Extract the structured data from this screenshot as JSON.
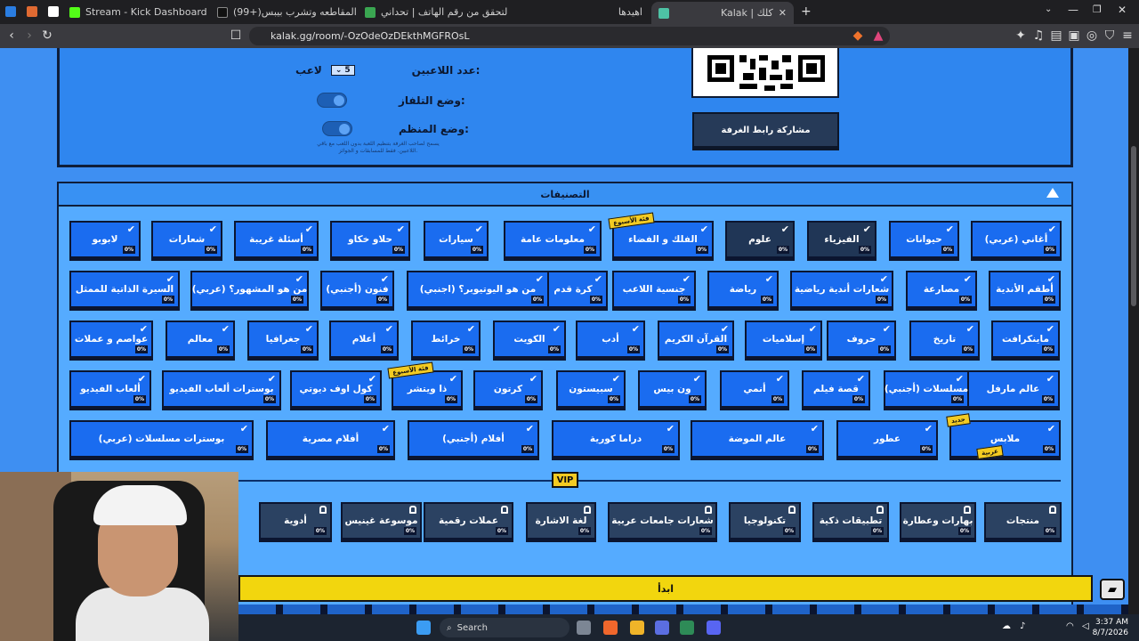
{
  "browser": {
    "tabs": [
      {
        "label": "Stream - Kick Dashboard"
      },
      {
        "label": "(99+)متنساش المقاطعه وتشرب بيبس"
      },
      {
        "label": "التحقق من رقم الهاتف | تحداني"
      },
      {
        "label": "اهيدها"
      },
      {
        "label": "Kalak | كلك"
      }
    ],
    "url": "kalak.gg/room/-OzOdeOzDEkthMGFROsL"
  },
  "settings": {
    "players_label": "عدد اللاعبين:",
    "players_value": "5",
    "players_unit": "لاعب",
    "tv_mode_label": "وضع التلفاز:",
    "organizer_mode_label": "وضع المنظم:",
    "organizer_note": "يسمح لصاحب الغرفة بتنظيم اللعبة بدون اللعب مع باقي اللاعبين. فقط للمسابقات و الجوائز."
  },
  "share_button": "مشاركة رابط الغرفة",
  "categories_title": "التصنيفات",
  "vip_label": "VIP",
  "start_button": "ابدأ",
  "rows": [
    [
      {
        "label": "أغاني (عربي)",
        "pct": "0%"
      },
      {
        "label": "حيوانات",
        "pct": "0%"
      },
      {
        "label": "الفيزياء",
        "pct": "0%"
      },
      {
        "label": "علوم",
        "pct": "0%"
      },
      {
        "label": "الفلك و الفضاء",
        "pct": "0%"
      },
      {
        "label": "معلومات عامة",
        "pct": "0%"
      },
      {
        "label": "سيارات",
        "pct": "0%"
      },
      {
        "label": "حلاو خكاو",
        "pct": "0%"
      },
      {
        "label": "أسئلة غريبة",
        "pct": "0%"
      },
      {
        "label": "شعارات",
        "pct": "0%"
      },
      {
        "label": "لابوبو",
        "pct": "0%"
      }
    ],
    [
      {
        "label": "أطقم الأندية",
        "pct": "0%"
      },
      {
        "label": "مصارعة",
        "pct": "0%"
      },
      {
        "label": "شعارات أندية رياضية",
        "pct": "0%"
      },
      {
        "label": "رياضة",
        "pct": "0%"
      },
      {
        "label": "جنسية اللاعب",
        "pct": "0%"
      },
      {
        "label": "كرة قدم",
        "pct": "0%"
      },
      {
        "label": "من هو اليوتيوبر؟ (اجنبي)",
        "pct": "0%"
      },
      {
        "label": "فنون (أجنبي)",
        "pct": "0%"
      },
      {
        "label": "من هو المشهور؟ (عربي)",
        "pct": "0%"
      },
      {
        "label": "السيرة الذاتية للممثل",
        "pct": "0%"
      }
    ],
    [
      {
        "label": "ماينكرافت",
        "pct": "0%"
      },
      {
        "label": "تاريخ",
        "pct": "0%"
      },
      {
        "label": "حروف",
        "pct": "0%"
      },
      {
        "label": "إسلاميات",
        "pct": "0%"
      },
      {
        "label": "القرآن الكريم",
        "pct": "0%"
      },
      {
        "label": "أدب",
        "pct": "0%"
      },
      {
        "label": "الكويت",
        "pct": "0%"
      },
      {
        "label": "خرائط",
        "pct": "0%"
      },
      {
        "label": "أعلام",
        "pct": "0%"
      },
      {
        "label": "جغرافيا",
        "pct": "0%"
      },
      {
        "label": "معالم",
        "pct": "0%"
      },
      {
        "label": "عواصم و عملات",
        "pct": "0%"
      }
    ],
    [
      {
        "label": "عالم مارفل",
        "pct": "0%"
      },
      {
        "label": "مسلسلات (أجنبي)",
        "pct": "0%"
      },
      {
        "label": "قصة فيلم",
        "pct": "0%"
      },
      {
        "label": "أنمي",
        "pct": "0%"
      },
      {
        "label": "ون بيس",
        "pct": "0%"
      },
      {
        "label": "سبيستون",
        "pct": "0%"
      },
      {
        "label": "كرتون",
        "pct": "0%"
      },
      {
        "label": "ذا ويتشر",
        "pct": "0%"
      },
      {
        "label": "كول اوف ديوتي",
        "pct": "0%"
      },
      {
        "label": "بوسترات ألعاب الفيديو",
        "pct": "0%"
      },
      {
        "label": "ألعاب الفيديو",
        "pct": "0%"
      }
    ],
    [
      {
        "label": "ملابس",
        "pct": "0%"
      },
      {
        "label": "عطور",
        "pct": "0%"
      },
      {
        "label": "عالم الموضة",
        "pct": "0%"
      },
      {
        "label": "دراما كورية",
        "pct": "0%"
      },
      {
        "label": "أفلام (أجنبي)",
        "pct": "0%"
      },
      {
        "label": "أفلام مصرية",
        "pct": "0%"
      },
      {
        "label": "بوسترات مسلسلات (عربي)",
        "pct": "0%"
      }
    ]
  ],
  "vip_row": [
    {
      "label": "منتجات",
      "pct": "0%"
    },
    {
      "label": "بهارات وعطارة",
      "pct": "0%"
    },
    {
      "label": "تطبيقات ذكية",
      "pct": "0%"
    },
    {
      "label": "تكنولوجيا",
      "pct": "0%"
    },
    {
      "label": "شعارات جامعات عربية",
      "pct": "0%"
    },
    {
      "label": "لغة الاشارة",
      "pct": "0%"
    },
    {
      "label": "عملات رقمية",
      "pct": "0%"
    },
    {
      "label": "موسوعة غينيس",
      "pct": "0%"
    },
    {
      "label": "أدوية",
      "pct": "0%"
    }
  ],
  "badges": {
    "week_label": "فئة الأسبوع",
    "new_label": "جديد",
    "arabic_label": "عربية"
  },
  "taskbar": {
    "search_placeholder": "Search",
    "time": "3:37 AM",
    "date": "8/7/2026"
  }
}
